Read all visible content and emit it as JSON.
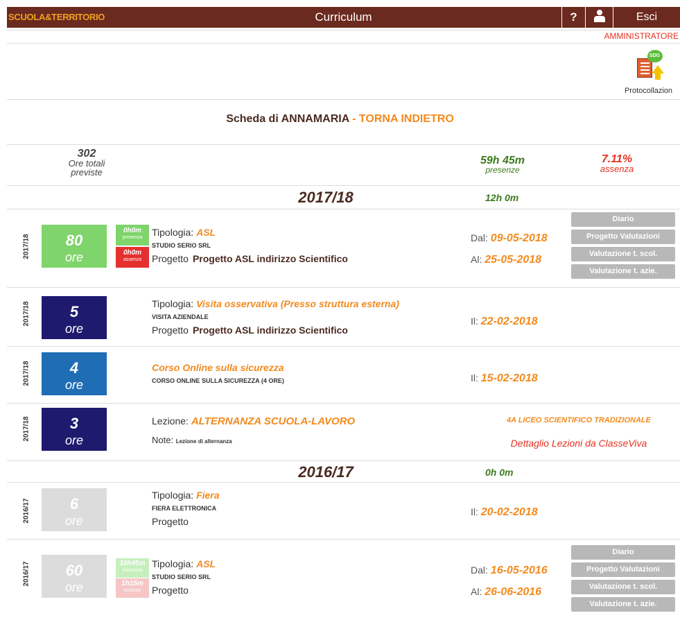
{
  "header": {
    "logo_text": "SCUOLA&TERRITORIO",
    "title": "Curriculum",
    "help_label": "?",
    "logout_label": "Esci",
    "role": "AMMINISTRATORE"
  },
  "protocol": {
    "label": "Protocollazion",
    "badge": "SDG"
  },
  "heading": {
    "text": "Scheda di ANNAMARIA",
    "back_link": "- TORNA INDIETRO"
  },
  "summary": {
    "total_hours": "302",
    "total_label_1": "Ore totali",
    "total_label_2": "previste",
    "presence_value": "59h 45m",
    "presence_label": "presenze",
    "absence_value": "7.11%",
    "absence_label": "assenza"
  },
  "years": [
    {
      "title": "2017/18",
      "hours": "12h 0m",
      "activities": [
        {
          "year": "2017/18",
          "hours": "80",
          "unit": "ore",
          "presence": "0h0m",
          "presence_label": "presenza",
          "absence": "0h0m",
          "absence_label": "assenza",
          "type_label": "Tipologia:",
          "type": "ASL",
          "company": "STUDIO SERIO SRL",
          "project_label": "Progetto",
          "project": "Progetto ASL indirizzo Scientifico",
          "from_label": "Dal:",
          "from": "09-05-2018",
          "to_label": "Al:",
          "to": "25-05-2018",
          "actions": [
            "Diario",
            "Progetto Valutazioni",
            "Valutazione t. scol.",
            "Valutazione t. azie."
          ]
        },
        {
          "year": "2017/18",
          "hours": "5",
          "unit": "ore",
          "type_label": "Tipologia:",
          "type": "Visita osservativa (Presso struttura esterna)",
          "company": "VISITA AZIENDALE",
          "project_label": "Progetto",
          "project": "Progetto ASL indirizzo Scientifico",
          "date_label": "Il:",
          "date": "22-02-2018"
        },
        {
          "year": "2017/18",
          "hours": "4",
          "unit": "ore",
          "course": "Corso Online sulla sicurezza",
          "company": "CORSO ONLINE SULLA SICUREZZA (4 ORE)",
          "date_label": "Il:",
          "date": "15-02-2018"
        },
        {
          "year": "2017/18",
          "hours": "3",
          "unit": "ore",
          "lesson_label": "Lezione:",
          "lesson": "ALTERNANZA SCUOLA-LAVORO",
          "note_label": "Note:",
          "note": "Lezione di alternanza",
          "class_name": "4A LICEO SCIENTIFICO TRADIZIONALE",
          "details_link": "Dettaglio Lezioni da ClasseViva"
        }
      ]
    },
    {
      "title": "2016/17",
      "hours": "0h 0m",
      "activities": [
        {
          "year": "2016/17",
          "hours": "6",
          "unit": "ore",
          "type_label": "Tipologia:",
          "type": "Fiera",
          "company": "FIERA ELETTRONICA",
          "project_label": "Progetto",
          "date_label": "Il:",
          "date": "20-02-2018"
        },
        {
          "year": "2016/17",
          "hours": "60",
          "unit": "ore",
          "presence": "10h45m",
          "presence_label": "presenza",
          "absence": "1h15m",
          "absence_label": "assente",
          "type_label": "Tipologia:",
          "type": "ASL",
          "company": "STUDIO SERIO SRL",
          "project_label": "Progetto",
          "from_label": "Dal:",
          "from": "16-05-2016",
          "to_label": "Al:",
          "to": "26-06-2016",
          "actions": [
            "Diario",
            "Progetto Valutazioni",
            "Valutazione t. scol.",
            "Valutazione t. azie."
          ]
        }
      ]
    }
  ],
  "colors": {
    "topbar": "#6b2a1f",
    "accent_orange": "#f28a1e",
    "presence_green": "#3c7a1e",
    "absence_red": "#e53020",
    "navy": "#1e1a6e",
    "blue": "#1f6db5",
    "green_box": "#7fd46b",
    "action_gray": "#b8b8b8"
  },
  "icons": {
    "help": "question-mark-icon",
    "user": "user-icon",
    "protocol": "document-protocol-icon"
  }
}
